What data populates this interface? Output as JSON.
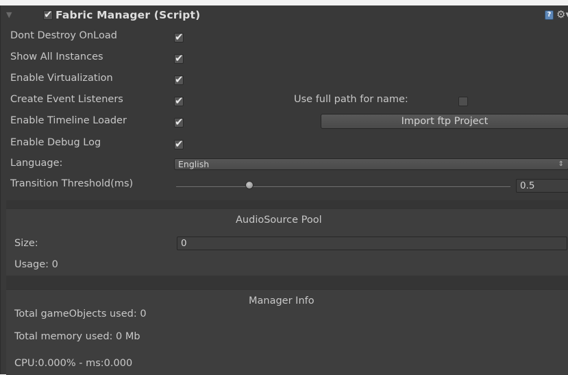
{
  "header": {
    "foldout_glyph": "▼",
    "enabled": true,
    "title": "Fabric Manager (Script)",
    "help_icon": "?",
    "gear_icon": "⚙▾"
  },
  "fields": {
    "dont_destroy_label": "Dont Destroy OnLoad",
    "show_all_label": "Show All Instances",
    "virtualization_label": "Enable Virtualization",
    "event_listeners_label": "Create Event Listeners",
    "timeline_loader_label": "Enable Timeline Loader",
    "debug_log_label": "Enable Debug Log",
    "language_label": "Language:",
    "language_value": "English",
    "threshold_label": "Transition Threshold(ms)",
    "threshold_value": "0.5",
    "threshold_fraction": 0.22,
    "full_path_label": "Use full path for name:",
    "import_button": "Import ftp Project"
  },
  "checks": {
    "dont_destroy": true,
    "show_all": true,
    "virtualization": true,
    "event_listeners": true,
    "timeline_loader": true,
    "debug_log": true,
    "full_path": false
  },
  "audio_pool": {
    "heading": "AudioSource Pool",
    "size_label": "Size:",
    "size_value": "0",
    "usage_text": "Usage: 0"
  },
  "manager_info": {
    "heading": "Manager Info",
    "game_objects": "Total gameObjects used: 0",
    "memory": "Total memory used: 0 Mb",
    "cpu": "CPU:0.000% - ms:0.000"
  },
  "colors": {
    "panel_bg": "#393939",
    "text": "#c8c8c8",
    "help_icon": "#5d87b8"
  },
  "glyphs": {
    "checkmark": "✔",
    "dropdown_arrows": "⇕"
  }
}
